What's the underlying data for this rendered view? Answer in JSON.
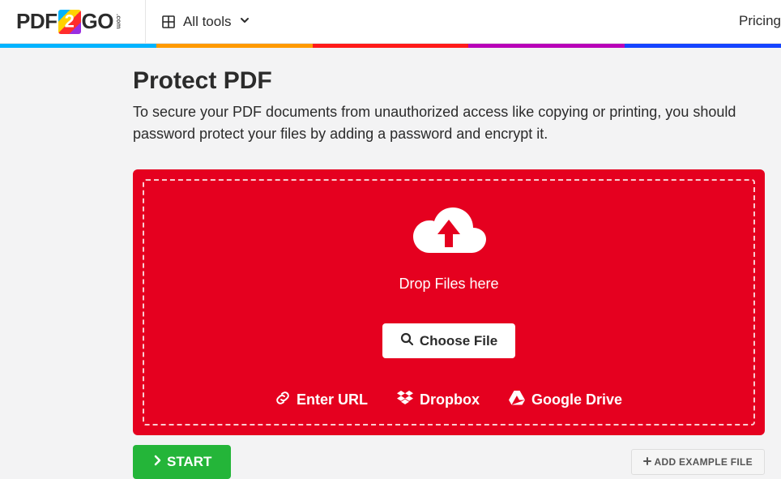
{
  "header": {
    "logo": {
      "pdf": "PDF",
      "two": "2",
      "go": "GO",
      "com": ".com"
    },
    "all_tools_label": "All tools",
    "pricing_label": "Pricing"
  },
  "page": {
    "title": "Protect PDF",
    "subtitle": "To secure your PDF documents from unauthorized access like copying or printing, you should password protect your files by adding a password and encrypt it."
  },
  "upload": {
    "drop_label": "Drop Files here",
    "choose_label": "Choose File",
    "sources": {
      "url": "Enter URL",
      "dropbox": "Dropbox",
      "gdrive": "Google Drive"
    }
  },
  "actions": {
    "start": "START",
    "add_example": "ADD EXAMPLE FILE"
  }
}
